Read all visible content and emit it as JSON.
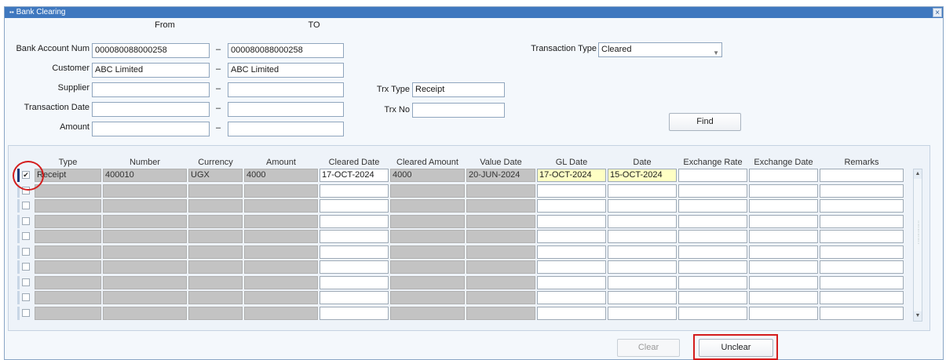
{
  "window": {
    "title": "Bank Clearing",
    "close_label": "×"
  },
  "criteria": {
    "from_header": "From",
    "to_header": "TO",
    "bank_account_label": "Bank Account Num",
    "bank_account_from": "000080088000258",
    "bank_account_to": "000080088000258",
    "customer_label": "Customer",
    "customer_from": "ABC Limited",
    "customer_to": "ABC Limited",
    "supplier_label": "Supplier",
    "supplier_from": "",
    "supplier_to": "",
    "transaction_date_label": "Transaction Date",
    "transaction_date_from": "",
    "transaction_date_to": "",
    "amount_label": "Amount",
    "amount_from": "",
    "amount_to": "",
    "dash": "–",
    "transaction_type_label": "Transaction Type",
    "transaction_type_value": "Cleared",
    "trx_type_label": "Trx Type",
    "trx_type_value": "Receipt",
    "trx_no_label": "Trx No",
    "trx_no_value": "",
    "find_label": "Find"
  },
  "grid": {
    "headers": [
      "Type",
      "Number",
      "Currency",
      "Amount",
      "Cleared Date",
      "Cleared Amount",
      "Value Date",
      "GL Date",
      "Date",
      "Exchange Rate",
      "Exchange Date",
      "Remarks"
    ],
    "rows": [
      {
        "checked": true,
        "check_glyph": "✔",
        "type": "Receipt",
        "number": "400010",
        "currency": "UGX",
        "amount": "4000",
        "cleared_date": "17-OCT-2024",
        "cleared_amount": "4000",
        "value_date": "20-JUN-2024",
        "gl_date": "17-OCT-2024",
        "date": "15-OCT-2024",
        "exchange_rate": "",
        "exchange_date": "",
        "remarks": ""
      }
    ],
    "empty_row_count": 9,
    "scroll_up": "▲",
    "scroll_down": "▼"
  },
  "footer": {
    "clear_label": "Clear",
    "unclear_label": "Unclear"
  },
  "colors": {
    "titlebar": "#3f78bf",
    "readonly_cell": "#c3c3c3",
    "required_cell": "#ffffc4",
    "annotation": "#d41c1c"
  }
}
